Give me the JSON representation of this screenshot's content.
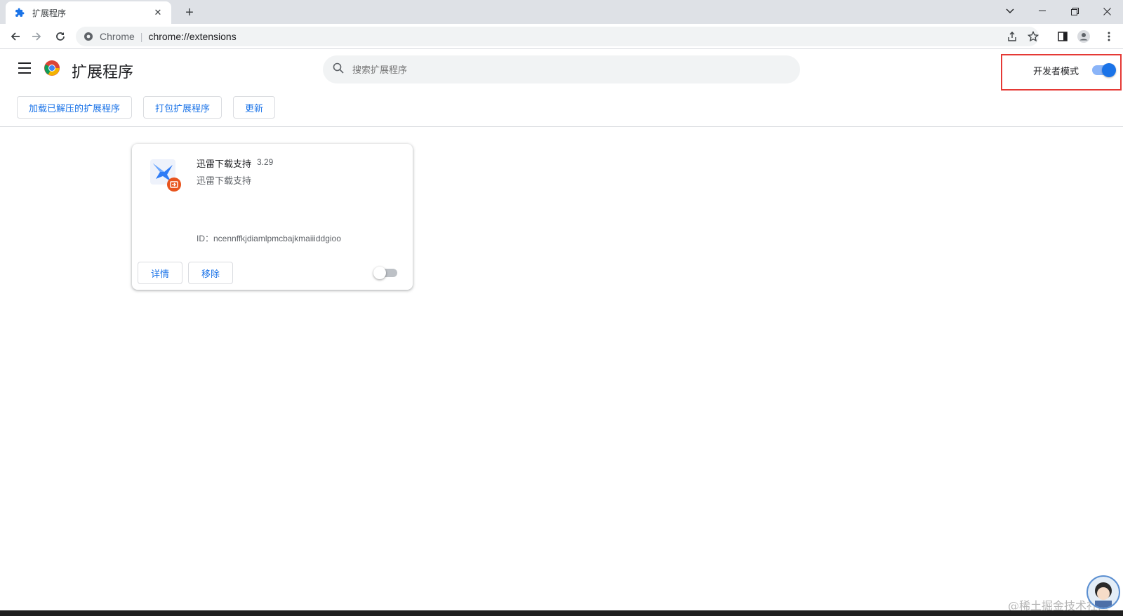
{
  "tab": {
    "title": "扩展程序",
    "icon": "puzzle-icon"
  },
  "omnibox": {
    "site": "Chrome",
    "separator": "|",
    "url": "chrome://extensions"
  },
  "header": {
    "title": "扩展程序",
    "search_placeholder": "搜索扩展程序",
    "dev_mode_label": "开发者模式",
    "dev_mode_on": true
  },
  "actions": {
    "load_unpacked": "加载已解压的扩展程序",
    "pack": "打包扩展程序",
    "update": "更新"
  },
  "extension": {
    "name": "迅雷下载支持",
    "version": "3.29",
    "description": "迅雷下载支持",
    "id": "ID：ncennffkjdiamlpmcbajkmaiiiddgioo",
    "details_label": "详情",
    "remove_label": "移除",
    "enabled": false
  },
  "watermark": "@稀土掘金技术社区",
  "colors": {
    "accent": "#1a73e8",
    "highlight_box": "#e53935"
  }
}
